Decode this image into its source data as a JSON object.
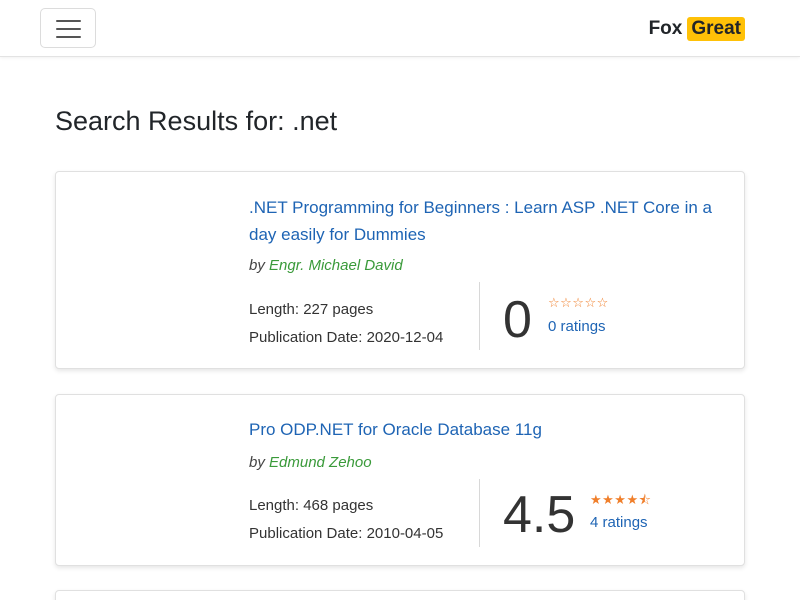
{
  "navbar": {
    "brand_first": "Fox",
    "brand_second": "Great"
  },
  "page": {
    "heading": "Search Results for: .net"
  },
  "results": [
    {
      "title": ".NET Programming for Beginners : Learn ASP .NET Core in a day easily for Dummies",
      "by_prefix": "by",
      "author": "Engr. Michael David",
      "length": "Length: 227 pages",
      "publication": "Publication Date: 2020-12-04",
      "rating": "0",
      "stars": "☆☆☆☆☆",
      "ratings_count": "0 ratings"
    },
    {
      "title": "Pro ODP.NET for Oracle Database 11g",
      "by_prefix": "by",
      "author": "Edmund Zehoo",
      "length": "Length: 468 pages",
      "publication": "Publication Date: 2010-04-05",
      "rating": "4.5",
      "stars": "★★★★⯪",
      "ratings_count": "4 ratings"
    }
  ],
  "colors": {
    "link": "#1e64b4",
    "author": "#3a9a3a",
    "star": "#f07f2b",
    "brand_badge": "#ffc107"
  },
  "icons": {
    "menu": "hamburger-icon",
    "stars": "star-icon"
  }
}
